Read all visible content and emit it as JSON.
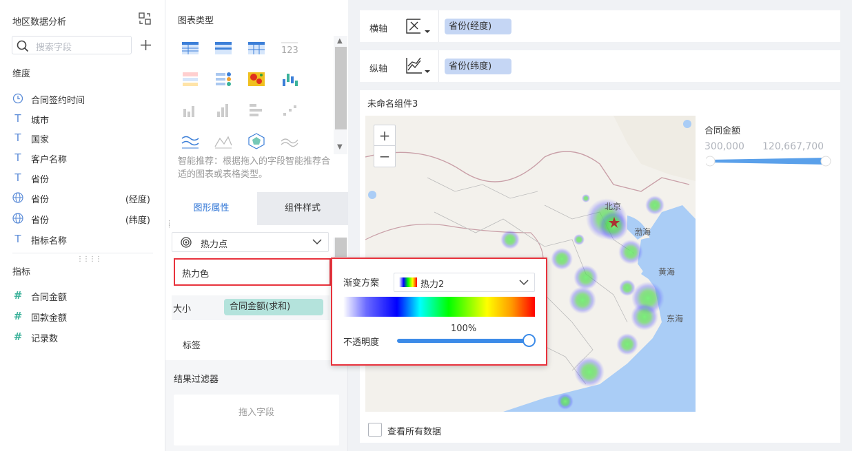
{
  "left": {
    "title": "地区数据分析",
    "search_placeholder": "搜索字段",
    "dim_label": "维度",
    "dimensions": [
      {
        "name": "合同签约时间",
        "sub": "",
        "icon": "clock-icon"
      },
      {
        "name": "城市",
        "sub": "",
        "icon": "text-type-icon"
      },
      {
        "name": "国家",
        "sub": "",
        "icon": "text-type-icon"
      },
      {
        "name": "客户名称",
        "sub": "",
        "icon": "text-type-icon"
      },
      {
        "name": "省份",
        "sub": "",
        "icon": "text-type-icon"
      },
      {
        "name": "省份",
        "sub": "(经度)",
        "icon": "globe-icon"
      },
      {
        "name": "省份",
        "sub": "(纬度)",
        "icon": "globe-icon"
      },
      {
        "name": "指标名称",
        "sub": "",
        "icon": "text-type-icon"
      }
    ],
    "measure_label": "指标",
    "measures": [
      {
        "name": "合同金额",
        "icon": "number-icon"
      },
      {
        "name": "回款金额",
        "icon": "number-icon"
      },
      {
        "name": "记录数",
        "icon": "number-icon"
      }
    ]
  },
  "middle": {
    "chart_type_title": "图表类型",
    "smart_hint": "智能推荐：根据拖入的字段智能推荐合适的图表或表格类型。",
    "tab_graph": "图形属性",
    "tab_style": "组件样式",
    "heat_type": "热力点",
    "heat_color": "热力色",
    "size_label": "大小",
    "size_field": "合同金额(求和)",
    "label_label": "标签",
    "filter_title": "结果过滤器",
    "drop_hint": "拖入字段"
  },
  "right": {
    "x_label": "横轴",
    "x_field": "省份(经度)",
    "y_label": "纵轴",
    "y_field": "省份(纬度)",
    "widget_title": "未命名组件3",
    "map_labels": {
      "beijing": "北京",
      "bohai": "渤海",
      "yellow_sea": "黄海",
      "east_sea": "东海"
    },
    "legend_title": "合同金额",
    "legend_min": "300,000",
    "legend_max": "120,667,700",
    "check_all": "查看所有数据",
    "zoom_in": "+",
    "zoom_out": "−"
  },
  "popup": {
    "gradient_label": "渐变方案",
    "gradient_value": "热力2",
    "opacity_pct": "100%",
    "opacity_label": "不透明度",
    "opacity_value": 1.0
  },
  "colors": {
    "accent": "#2f75d6",
    "highlight_border": "#e8323c",
    "axis_tag": "#c5d6f4",
    "size_tag": "#b4e3dc"
  }
}
